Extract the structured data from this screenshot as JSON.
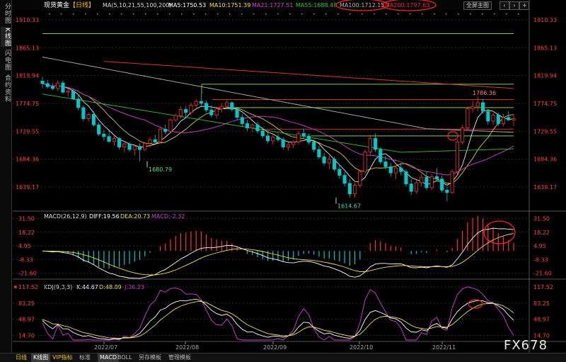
{
  "sidebar": {
    "tabs": [
      {
        "label": "分时图",
        "active": false
      },
      {
        "label": "K线图",
        "active": true
      },
      {
        "label": "闪电图",
        "active": false
      },
      {
        "label": "合约资料",
        "active": false
      }
    ]
  },
  "header": {
    "title": "现货黄金",
    "period": "【日线】",
    "ma_label": "MA(5,10,21,55,100,200)",
    "ma": [
      {
        "label": "MA5:1750.53",
        "color": "#ffffff"
      },
      {
        "label": "MA10:1751.39",
        "color": "#f0e040"
      },
      {
        "label": "MA21:1727.51",
        "color": "#d040d0"
      },
      {
        "label": "MA55:1688.48",
        "color": "#30c030"
      },
      {
        "label": "MA100:1712.15",
        "color": "#b0b0b0"
      },
      {
        "label": "MA200:1797.63",
        "color": "#e03030"
      }
    ],
    "fullscreen_label": "全屏主图"
  },
  "price_axis": {
    "ticks": [
      "1910.33",
      "1865.13",
      "1819.94",
      "1774.75",
      "1729.55",
      "1684.36",
      "1639.17"
    ],
    "values": [
      1910.33,
      1865.13,
      1819.94,
      1774.75,
      1729.55,
      1684.36,
      1639.17
    ]
  },
  "macd": {
    "label": "MACD(26,12,9)",
    "diff_label": "DIFF:19.56",
    "dea_label": "DEA:20.73",
    "macd_label": "MACD:-2.32",
    "ticks": [
      "31.50",
      "18.22",
      "4.95",
      "-8.33",
      "-21.60"
    ],
    "values": [
      31.5,
      18.22,
      4.95,
      -8.33,
      -21.6
    ]
  },
  "kdj": {
    "label": "KDJ(9,3,3)",
    "k_label": "K:44.67",
    "d_label": "D:48.89",
    "j_label": "J:36.23",
    "ticks": [
      "117.52",
      "83.25",
      "48.97",
      "14.70"
    ],
    "values": [
      117.52,
      83.25,
      48.97,
      14.7
    ]
  },
  "x_axis": {
    "months": [
      "2022/07",
      "2022/08",
      "2022/09",
      "2022/10",
      "2022/11"
    ]
  },
  "annotations": {
    "high": "1786.36",
    "low1": "1680.79",
    "low2": "1614.67"
  },
  "bottom_bar": {
    "items": [
      "日线",
      "K线图",
      "VIP指标",
      "标准",
      "MACD",
      "BOLL",
      "另存模板",
      "管理模板"
    ]
  },
  "watermark": "FX678",
  "colors": {
    "up": "#ff3030",
    "down": "#00c8c8",
    "bg": "#000000",
    "grid": "#2a2a2a",
    "price_label": "#ff4040",
    "hline_green": "#7fd040",
    "hline_red": "#d03030",
    "circle": "#ff2020"
  },
  "chart_data": {
    "type": "candlestick",
    "title": "现货黄金 日线",
    "ylim": [
      1600,
      1915
    ],
    "dates_axis": [
      "2022/07",
      "2022/08",
      "2022/09",
      "2022/10",
      "2022/11"
    ],
    "candles": [
      [
        1811,
        1818,
        1800,
        1807
      ],
      [
        1807,
        1813,
        1799,
        1802
      ],
      [
        1802,
        1808,
        1796,
        1799
      ],
      [
        1799,
        1812,
        1795,
        1808
      ],
      [
        1808,
        1812,
        1790,
        1793
      ],
      [
        1793,
        1802,
        1786,
        1795
      ],
      [
        1795,
        1797,
        1780,
        1782
      ],
      [
        1782,
        1790,
        1764,
        1768
      ],
      [
        1768,
        1772,
        1746,
        1750
      ],
      [
        1750,
        1760,
        1745,
        1757
      ],
      [
        1757,
        1762,
        1737,
        1740
      ],
      [
        1740,
        1744,
        1722,
        1725
      ],
      [
        1725,
        1732,
        1715,
        1721
      ],
      [
        1721,
        1730,
        1711,
        1713
      ],
      [
        1713,
        1722,
        1706,
        1718
      ],
      [
        1718,
        1720,
        1700,
        1704
      ],
      [
        1704,
        1712,
        1695,
        1709
      ],
      [
        1709,
        1712,
        1696,
        1700
      ],
      [
        1700,
        1708,
        1690,
        1705
      ],
      [
        1705,
        1710,
        1681,
        1700
      ],
      [
        1700,
        1712,
        1698,
        1710
      ],
      [
        1710,
        1720,
        1703,
        1716
      ],
      [
        1716,
        1724,
        1710,
        1712
      ],
      [
        1712,
        1735,
        1710,
        1733
      ],
      [
        1733,
        1740,
        1725,
        1729
      ],
      [
        1729,
        1750,
        1726,
        1748
      ],
      [
        1748,
        1758,
        1745,
        1755
      ],
      [
        1755,
        1770,
        1750,
        1765
      ],
      [
        1765,
        1770,
        1752,
        1760
      ],
      [
        1760,
        1776,
        1756,
        1772
      ],
      [
        1772,
        1782,
        1768,
        1778
      ],
      [
        1778,
        1790,
        1770,
        1775
      ],
      [
        1775,
        1780,
        1760,
        1764
      ],
      [
        1764,
        1772,
        1752,
        1756
      ],
      [
        1756,
        1770,
        1750,
        1766
      ],
      [
        1766,
        1775,
        1760,
        1770
      ],
      [
        1770,
        1780,
        1766,
        1776
      ],
      [
        1776,
        1778,
        1762,
        1765
      ],
      [
        1765,
        1768,
        1748,
        1752
      ],
      [
        1752,
        1758,
        1738,
        1742
      ],
      [
        1742,
        1748,
        1730,
        1735
      ],
      [
        1735,
        1742,
        1728,
        1740
      ],
      [
        1740,
        1745,
        1726,
        1730
      ],
      [
        1730,
        1736,
        1718,
        1722
      ],
      [
        1722,
        1728,
        1710,
        1714
      ],
      [
        1714,
        1724,
        1708,
        1720
      ],
      [
        1720,
        1726,
        1712,
        1716
      ],
      [
        1716,
        1720,
        1700,
        1704
      ],
      [
        1704,
        1712,
        1698,
        1708
      ],
      [
        1708,
        1716,
        1702,
        1712
      ],
      [
        1712,
        1730,
        1708,
        1726
      ],
      [
        1726,
        1734,
        1718,
        1722
      ],
      [
        1722,
        1726,
        1708,
        1712
      ],
      [
        1712,
        1716,
        1696,
        1700
      ],
      [
        1700,
        1706,
        1684,
        1688
      ],
      [
        1688,
        1694,
        1674,
        1678
      ],
      [
        1678,
        1690,
        1668,
        1684
      ],
      [
        1684,
        1688,
        1664,
        1668
      ],
      [
        1668,
        1676,
        1652,
        1658
      ],
      [
        1658,
        1664,
        1640,
        1645
      ],
      [
        1645,
        1652,
        1622,
        1628
      ],
      [
        1628,
        1646,
        1622,
        1642
      ],
      [
        1642,
        1668,
        1638,
        1664
      ],
      [
        1664,
        1700,
        1660,
        1696
      ],
      [
        1696,
        1724,
        1690,
        1718
      ],
      [
        1718,
        1726,
        1696,
        1700
      ],
      [
        1700,
        1704,
        1676,
        1680
      ],
      [
        1680,
        1690,
        1668,
        1672
      ],
      [
        1672,
        1678,
        1656,
        1662
      ],
      [
        1662,
        1674,
        1652,
        1670
      ],
      [
        1670,
        1678,
        1658,
        1664
      ],
      [
        1664,
        1668,
        1640,
        1644
      ],
      [
        1644,
        1652,
        1626,
        1632
      ],
      [
        1632,
        1650,
        1628,
        1646
      ],
      [
        1646,
        1660,
        1640,
        1655
      ],
      [
        1655,
        1664,
        1634,
        1638
      ],
      [
        1638,
        1660,
        1634,
        1656
      ],
      [
        1656,
        1670,
        1650,
        1652
      ],
      [
        1652,
        1658,
        1630,
        1634
      ],
      [
        1634,
        1640,
        1616,
        1630
      ],
      [
        1630,
        1668,
        1628,
        1664
      ],
      [
        1664,
        1716,
        1660,
        1712
      ],
      [
        1712,
        1740,
        1708,
        1735
      ],
      [
        1735,
        1770,
        1730,
        1766
      ],
      [
        1766,
        1780,
        1760,
        1770
      ],
      [
        1770,
        1786,
        1762,
        1776
      ],
      [
        1776,
        1782,
        1758,
        1762
      ],
      [
        1762,
        1766,
        1740,
        1746
      ],
      [
        1746,
        1760,
        1740,
        1756
      ],
      [
        1756,
        1760,
        1738,
        1742
      ],
      [
        1742,
        1758,
        1738,
        1752
      ],
      [
        1752,
        1762,
        1746,
        1748
      ],
      [
        1748,
        1756,
        1738,
        1750
      ]
    ]
  }
}
